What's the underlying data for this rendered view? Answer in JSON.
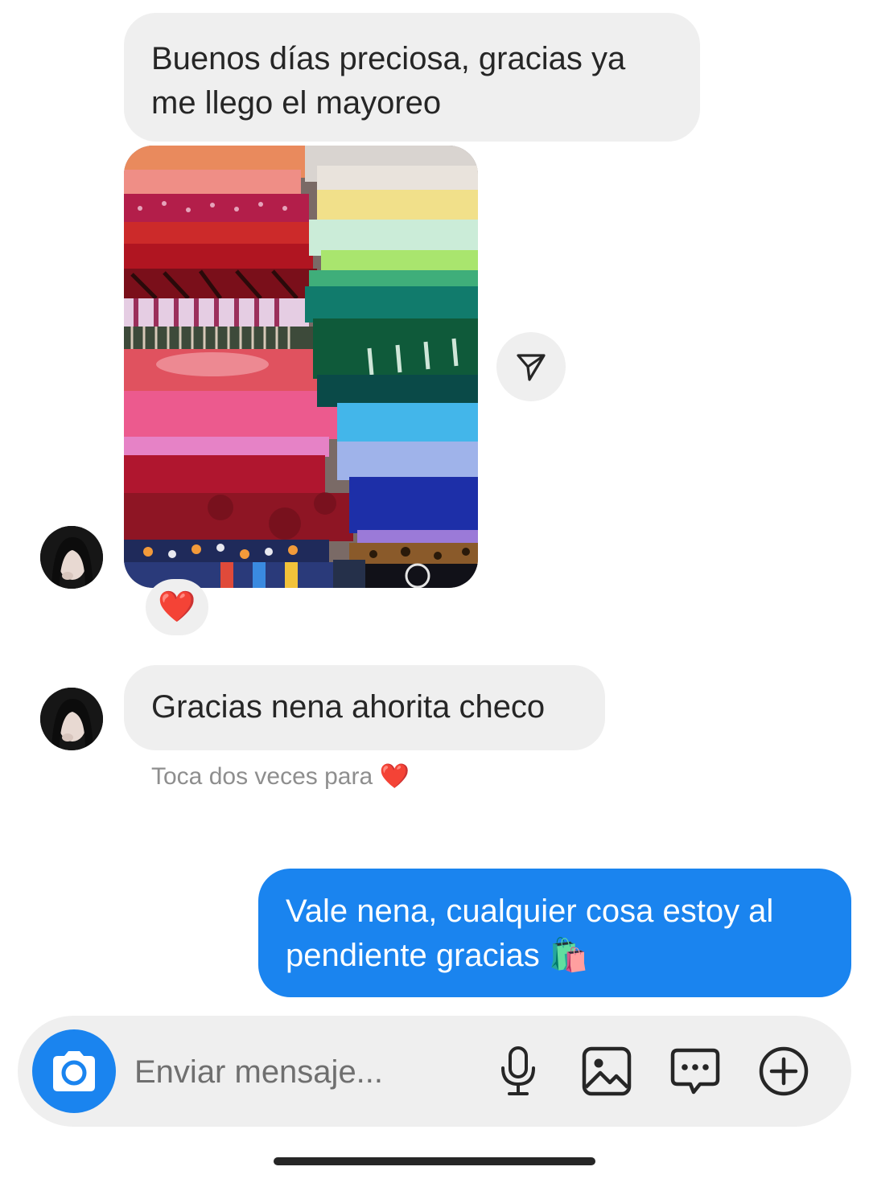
{
  "messages": [
    {
      "id": "m1",
      "direction": "incoming",
      "text": "Buenos días preciosa, gracias ya me llego el mayoreo"
    },
    {
      "id": "m2",
      "direction": "incoming",
      "type": "photo",
      "reaction": "❤️"
    },
    {
      "id": "m3",
      "direction": "incoming",
      "text": "Gracias nena ahorita checo"
    },
    {
      "id": "m4",
      "direction": "outgoing",
      "text": "Vale nena, cualquier cosa estoy al pendiente gracias 🛍️"
    }
  ],
  "hint": {
    "text": "Toca dos veces para",
    "emoji": "❤️"
  },
  "composer": {
    "placeholder": "Enviar mensaje...",
    "icons": [
      "camera-icon",
      "microphone-icon",
      "gallery-icon",
      "sticker-icon",
      "plus-icon"
    ]
  },
  "colors": {
    "incoming_bubble": "#efefef",
    "outgoing_bubble": "#1a84ef",
    "hint_text": "#8e8e8e"
  }
}
